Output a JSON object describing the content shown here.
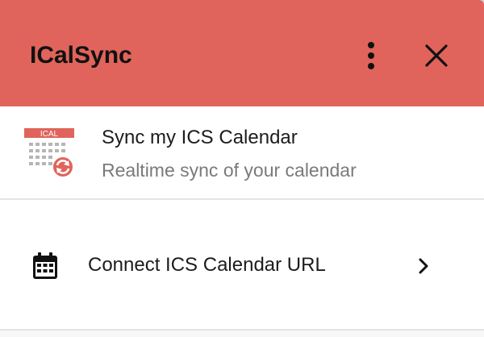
{
  "header": {
    "title": "ICalSync",
    "menu_icon": "more-vertical-icon",
    "close_icon": "close-icon",
    "background_color": "#e0645b"
  },
  "sync_item": {
    "logo_text": "ICAL",
    "logo_icon": "ical-sync-logo",
    "title": "Sync my ICS Calendar",
    "subtitle": "Realtime sync of your calendar",
    "accent_color": "#e0645b"
  },
  "connect_item": {
    "icon": "calendar-icon",
    "label": "Connect ICS Calendar URL",
    "chevron_icon": "chevron-right-icon"
  }
}
